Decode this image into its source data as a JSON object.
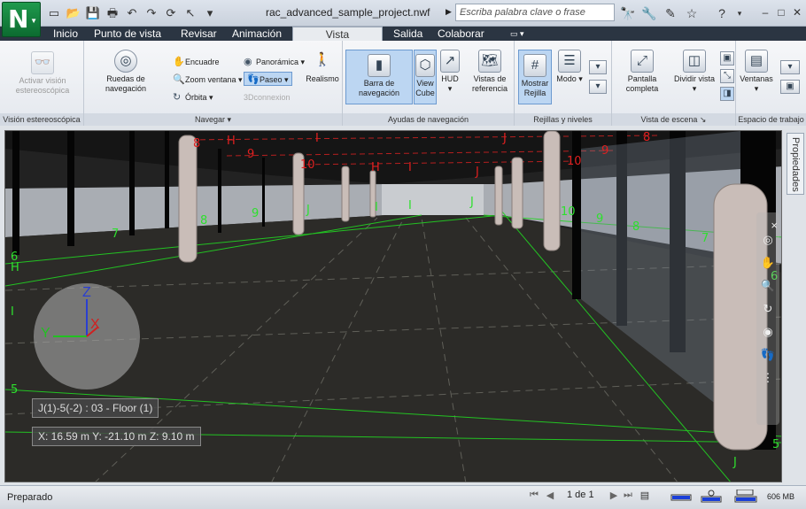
{
  "titlebar": {
    "doc_title": "rac_advanced_sample_project.nwf",
    "search_placeholder": "Escriba palabra clave o frase",
    "app_icon": "navisworks-logo-icon"
  },
  "tabs": [
    {
      "label": "Inicio"
    },
    {
      "label": "Punto de vista"
    },
    {
      "label": "Revisar"
    },
    {
      "label": "Animación"
    },
    {
      "label": "Vista",
      "active": true
    },
    {
      "label": "Salida"
    },
    {
      "label": "Colaborar"
    }
  ],
  "ribbon": {
    "stereo": {
      "label": "Activar visión estereoscópica",
      "panel": "Visión estereoscópica"
    },
    "navigate": {
      "panel": "Navegar",
      "wheels": "Ruedas de navegación",
      "encuadre": "Encuadre",
      "zoom": "Zoom ventana",
      "orbita": "Órbita",
      "panoramica": "Panorámica",
      "paseo": "Paseo",
      "connexion": "3Dconnexion",
      "realismo": "Realismo"
    },
    "aids": {
      "panel": "Ayudas de navegación",
      "navbar": "Barra de navegación",
      "viewcube": "View Cube",
      "hud": "HUD",
      "refviews": "Vistas de referencia"
    },
    "grids": {
      "panel": "Rejillas y niveles",
      "show": "Mostrar Rejilla",
      "mode": "Modo"
    },
    "scene": {
      "panel": "Vista de escena",
      "fullscreen": "Pantalla completa",
      "split": "Dividir vista"
    },
    "workspace": {
      "panel": "Espacio de trabajo",
      "windows": "Ventanas"
    }
  },
  "viewport": {
    "level_label": "J(1)-5(-2) : 03 - Floor (1)",
    "coords_label": "X: 16.59 m  Y: -21.10 m  Z: 9.10 m",
    "axis_z": "Z",
    "axis_y": "Y",
    "axis_x": "X",
    "grid_labels_red": [
      "8",
      "H",
      "I",
      "J",
      "9",
      "10",
      "H",
      "I",
      "J",
      "10",
      "9",
      "8"
    ],
    "grid_labels_green": [
      "8",
      "9",
      "J",
      "I",
      "7",
      "6",
      "H",
      "I",
      "5",
      "J",
      "10",
      "9",
      "8",
      "7",
      "6",
      "5"
    ]
  },
  "props_tab": {
    "label": "Propiedades"
  },
  "status": {
    "text": "Preparado",
    "page": "1 de 1",
    "memory": "606 MB"
  }
}
